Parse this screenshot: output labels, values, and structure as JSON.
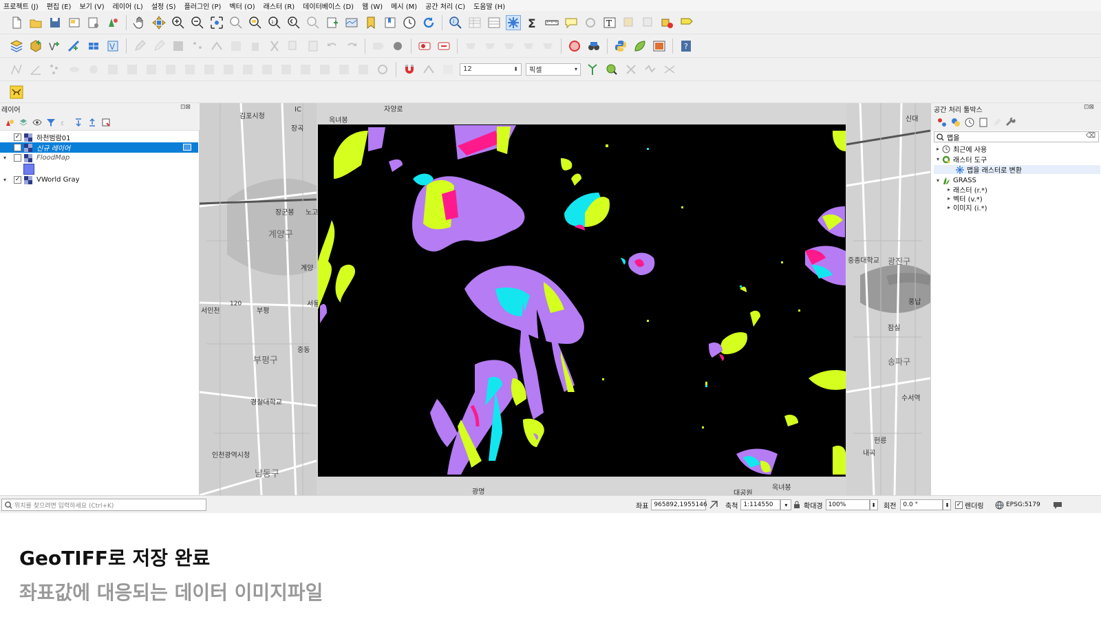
{
  "menu": [
    "프로젝트 (J)",
    "편집 (E)",
    "보기 (V)",
    "레이어 (L)",
    "설정 (S)",
    "플러그인 (P)",
    "벡터 (O)",
    "래스터 (R)",
    "데이터베이스 (D)",
    "웹 (W)",
    "메시 (M)",
    "공간 처리 (C)",
    "도움말 (H)"
  ],
  "toolbar": {
    "snap_tolerance": "12",
    "snap_unit": "픽셀"
  },
  "layers_panel": {
    "title": "레이어",
    "controls": "⊡⊠",
    "layers": [
      {
        "name": "하천범람01",
        "checked": true
      },
      {
        "name": "신규 레이어",
        "checked": false
      },
      {
        "name": "FloodMap",
        "checked": false
      },
      {
        "name": "VWorld Gray",
        "checked": true
      }
    ]
  },
  "map": {
    "labels": [
      "김포시청",
      "자양로",
      "IC",
      "장곡",
      "옥녀봉",
      "계양구",
      "장군봉",
      "노고",
      "계양",
      "서인천",
      "부평",
      "120",
      "서울",
      "부평구",
      "중동",
      "경찰대학교",
      "인천광역시청",
      "남동구",
      "광명",
      "대공원",
      "옥녀봉",
      "중종대학교",
      "풍납",
      "잠실",
      "수서역",
      "헌릉",
      "내곡",
      "신대",
      "광진구",
      "송파구"
    ],
    "colors": {
      "raster_bg": "#000000",
      "lime": "#d4ff1f",
      "violet": "#b57cf4",
      "cyan": "#14e6f0",
      "magenta": "#ff1a8c",
      "green": "#4fd45a"
    }
  },
  "processing_panel": {
    "title": "공간 처리 툴박스",
    "controls": "⊡⊠",
    "search_value": "맵을",
    "clear_icon": "⌫",
    "tree": [
      {
        "label": "최근에 사용",
        "level": 0,
        "icon": "clock-icon"
      },
      {
        "label": "래스터 도구",
        "level": 0,
        "icon": "qgis-icon"
      },
      {
        "label": "맵을 래스터로 변환",
        "level": 1,
        "icon": "gear-icon"
      },
      {
        "label": "GRASS",
        "level": 0,
        "icon": "grass-icon"
      },
      {
        "label": "래스터 (r.*)",
        "level": 1,
        "icon": ""
      },
      {
        "label": "벡터 (v.*)",
        "level": 1,
        "icon": ""
      },
      {
        "label": "이미지 (i.*)",
        "level": 1,
        "icon": ""
      }
    ]
  },
  "statusbar": {
    "locator_placeholder": "위치를 찾으려면 입력하세요 (Ctrl+K)",
    "coord_label": "좌표",
    "coord_value": "965892,1955146",
    "scale_label": "축척",
    "scale_value": "1:114550",
    "magnifier_label": "확대경",
    "magnifier_value": "100%",
    "rotation_label": "회전",
    "rotation_value": "0.0 °",
    "render_label": "렌더링",
    "crs": "EPSG:5179"
  },
  "caption": {
    "title": "GeoTIFF로 저장 완료",
    "subtitle": "좌표값에 대응되는 데이터 이미지파일"
  }
}
